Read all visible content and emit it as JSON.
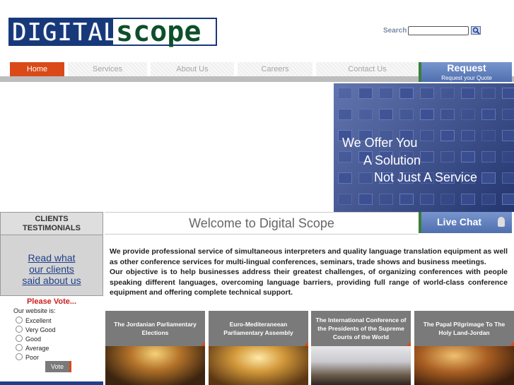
{
  "logo": {
    "part1": "DIGITAL",
    "part2": "scope"
  },
  "search": {
    "label": "Search",
    "value": "",
    "placeholder": ""
  },
  "nav": {
    "items": [
      {
        "label": "Home",
        "active": true
      },
      {
        "label": "Services",
        "active": false
      },
      {
        "label": "About Us",
        "active": false
      },
      {
        "label": "Careers",
        "active": false
      },
      {
        "label": "Contact Us",
        "active": false
      }
    ]
  },
  "request": {
    "title": "Request",
    "subtitle": "Request your Quote"
  },
  "banner": {
    "line1": "We Offer You",
    "line2": "A Solution",
    "line3": "Not Just A Service"
  },
  "testimonials": {
    "heading_line1": "CLIENTS",
    "heading_line2": "TESTIMONIALS",
    "link_line1": "Read what",
    "link_line2": "our clients",
    "link_line3": "said about us"
  },
  "poll": {
    "title": "Please Vote...",
    "question": "Our website is:",
    "options": [
      "Excellent",
      "Very Good",
      "Good",
      "Average",
      "Poor"
    ],
    "button": "Vote"
  },
  "welcome": {
    "title": "Welcome to Digital Scope"
  },
  "livechat": {
    "label": "Live Chat"
  },
  "intro": {
    "p1": "We provide professional service of simultaneous interpreters and quality language translation equipment as well as other conference services for multi-lingual conferences, seminars, trade shows and business meetings.",
    "p2": "Our objective is to help businesses address their greatest challenges, of organizing conferences with people speaking different languages, overcoming language barriers, providing full range of world-class conference equipment and offering complete technical support."
  },
  "cards": [
    {
      "title": "The Jordanian Parliamentary Elections"
    },
    {
      "title": "Euro-Mediteraneean Parliamentary Assembly"
    },
    {
      "title": "The International Conference of the Presidents of the Supreme Courts of the World"
    },
    {
      "title": "The Papal Pilgrimage To The Holy Land-Jordan"
    }
  ],
  "colors": {
    "accent": "#d94a18",
    "brand_blue": "#17397a",
    "brand_green": "#0d4f2a",
    "link": "#1f3f8a"
  }
}
